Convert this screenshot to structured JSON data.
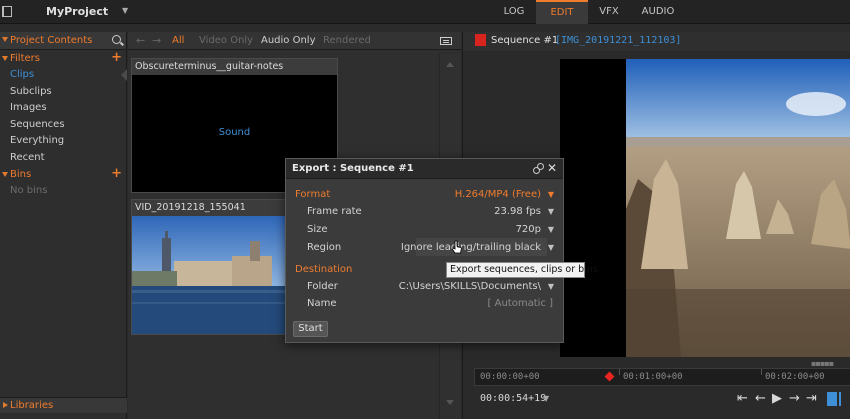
{
  "app": {
    "project_name": "MyProject"
  },
  "tabs": [
    {
      "label": "LOG",
      "active": false
    },
    {
      "label": "EDIT",
      "active": true
    },
    {
      "label": "VFX",
      "active": false
    },
    {
      "label": "AUDIO",
      "active": false
    }
  ],
  "sidebar": {
    "title": "Project Contents",
    "filters_label": "Filters",
    "filter_items": [
      "Clips",
      "Subclips",
      "Images",
      "Sequences",
      "Everything",
      "Recent"
    ],
    "active_item": "Clips",
    "bins_label": "Bins",
    "bins_empty": "No bins",
    "libraries_label": "Libraries"
  },
  "bin": {
    "filters": {
      "all": "All",
      "video_only": "Video Only",
      "audio_only": "Audio Only",
      "rendered": "Rendered"
    },
    "clips": [
      {
        "title": "Obscureterminus__guitar-notes",
        "content_label": "Sound"
      },
      {
        "title": "VID_20191218_155041"
      }
    ]
  },
  "viewer": {
    "sequence_title": "Sequence #1",
    "clip_id": "[IMG_20191221_112103]",
    "timeline": {
      "tc_start": "00:00:00+00",
      "tc_mid": "00:01:00+00",
      "tc_end": "00:02:00+00"
    },
    "current_timecode": "00:00:54+19"
  },
  "export_dialog": {
    "title": "Export : Sequence #1",
    "format_label": "Format",
    "format_value": "H.264/MP4 (Free)",
    "rows": {
      "frame_rate_label": "Frame rate",
      "frame_rate_value": "23.98 fps",
      "size_label": "Size",
      "size_value": "720p",
      "region_label": "Region",
      "region_value": "Ignore leading/trailing black"
    },
    "destination_label": "Destination",
    "folder_label": "Folder",
    "folder_value": "C:\\Users\\SKILLS\\Documents\\",
    "name_label": "Name",
    "name_value": "[ Automatic ]",
    "start_label": "Start"
  },
  "tooltip": {
    "text": "Export sequences, clips or bins"
  },
  "colors": {
    "accent_orange": "#f07c2e",
    "accent_blue": "#3e8fd6",
    "sequence_red": "#d8231e"
  }
}
